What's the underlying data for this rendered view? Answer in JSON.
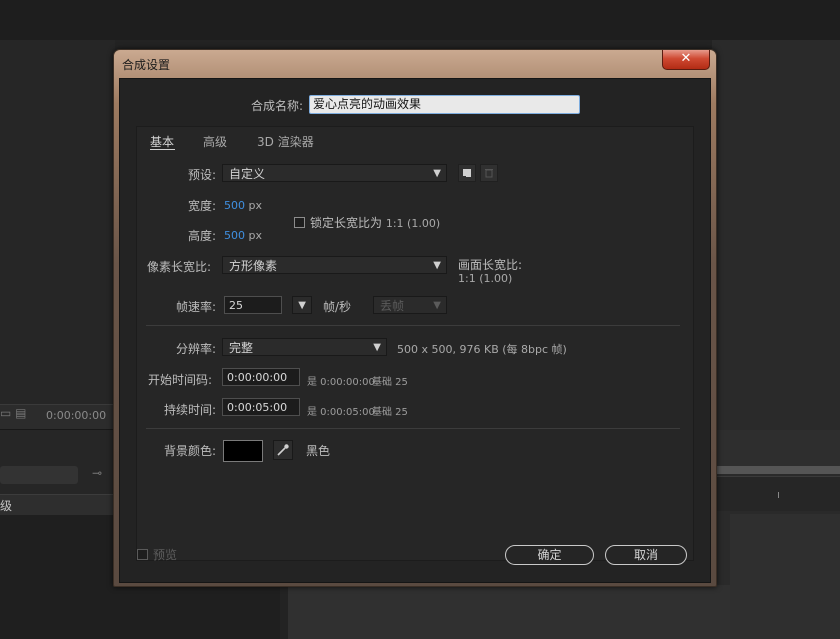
{
  "background": {
    "timecode": "0:00:00:00",
    "column_label": "级"
  },
  "dialog": {
    "title": "合成设置",
    "close_glyph": "✕",
    "comp_name_label": "合成名称:",
    "comp_name_value": "爱心点亮的动画效果",
    "tabs": [
      {
        "label": "基本",
        "active": true
      },
      {
        "label": "高级",
        "active": false
      },
      {
        "label": "3D 渲染器",
        "active": false
      }
    ],
    "preset": {
      "label": "预设:",
      "value": "自定义"
    },
    "width": {
      "label": "宽度:",
      "value": "500",
      "unit": "px"
    },
    "height": {
      "label": "高度:",
      "value": "500",
      "unit": "px"
    },
    "lock_aspect": {
      "label": "锁定长宽比为",
      "ratio": "1:1 (1.00)",
      "checked": false
    },
    "pixel_aspect": {
      "label": "像素长宽比:",
      "value": "方形像素"
    },
    "frame_aspect": {
      "label": "画面长宽比:",
      "value": "1:1 (1.00)"
    },
    "frame_rate": {
      "label": "帧速率:",
      "value": "25",
      "unit": "帧/秒",
      "drop_frame": "丢帧"
    },
    "resolution": {
      "label": "分辨率:",
      "value": "完整",
      "info": "500 x 500, 976 KB (每 8bpc 帧)"
    },
    "start_timecode": {
      "label": "开始时间码:",
      "value": "0:00:00:00",
      "equals": "是 0:00:00:00",
      "base": "基础 25"
    },
    "duration": {
      "label": "持续时间:",
      "value": "0:00:05:00",
      "equals": "是 0:00:05:00",
      "base": "基础 25"
    },
    "bg_color": {
      "label": "背景颜色:",
      "name": "黑色",
      "hex": "#000000"
    },
    "preview": {
      "label": "预览",
      "checked": false
    },
    "ok_label": "确定",
    "cancel_label": "取消"
  }
}
